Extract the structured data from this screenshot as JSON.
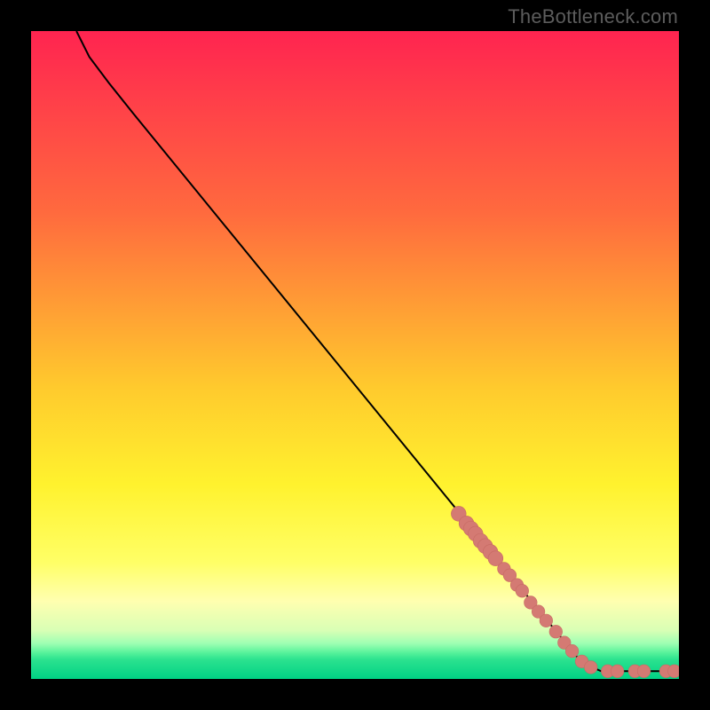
{
  "watermark": "TheBottleneck.com",
  "colors": {
    "background": "#000000",
    "curve": "#000000",
    "marker_fill": "#d47a73",
    "marker_stroke": "#c76a63",
    "gradient_stops": [
      {
        "offset": "0%",
        "color": "#ff2450"
      },
      {
        "offset": "28%",
        "color": "#ff6a3e"
      },
      {
        "offset": "55%",
        "color": "#ffca2d"
      },
      {
        "offset": "70%",
        "color": "#fff22e"
      },
      {
        "offset": "82%",
        "color": "#ffff66"
      },
      {
        "offset": "88%",
        "color": "#ffffb0"
      },
      {
        "offset": "92.5%",
        "color": "#d9ffb5"
      },
      {
        "offset": "94.5%",
        "color": "#9fffb3"
      },
      {
        "offset": "96%",
        "color": "#55f29a"
      },
      {
        "offset": "97%",
        "color": "#2ce28f"
      },
      {
        "offset": "100%",
        "color": "#00d184"
      }
    ]
  },
  "chart_data": {
    "type": "line",
    "title": "",
    "xlabel": "",
    "ylabel": "",
    "xlim": [
      0,
      100
    ],
    "ylim": [
      0,
      100
    ],
    "curve": [
      {
        "x": 7,
        "y": 100
      },
      {
        "x": 9,
        "y": 96
      },
      {
        "x": 12,
        "y": 92
      },
      {
        "x": 16,
        "y": 87
      },
      {
        "x": 85,
        "y": 2.5
      },
      {
        "x": 88,
        "y": 1.2
      },
      {
        "x": 100,
        "y": 1.2
      }
    ],
    "series": [
      {
        "name": "markers",
        "points": [
          {
            "x": 66.0,
            "y": 25.5,
            "r": 1.15
          },
          {
            "x": 67.2,
            "y": 24.0,
            "r": 1.15
          },
          {
            "x": 67.9,
            "y": 23.2,
            "r": 1.15
          },
          {
            "x": 68.6,
            "y": 22.4,
            "r": 1.15
          },
          {
            "x": 69.4,
            "y": 21.3,
            "r": 1.15
          },
          {
            "x": 70.1,
            "y": 20.5,
            "r": 1.15
          },
          {
            "x": 70.9,
            "y": 19.6,
            "r": 1.15
          },
          {
            "x": 71.7,
            "y": 18.6,
            "r": 1.15
          },
          {
            "x": 73.0,
            "y": 17.0,
            "r": 1.0
          },
          {
            "x": 73.9,
            "y": 16.0,
            "r": 1.0
          },
          {
            "x": 75.0,
            "y": 14.5,
            "r": 1.0
          },
          {
            "x": 75.8,
            "y": 13.6,
            "r": 1.0
          },
          {
            "x": 77.1,
            "y": 11.8,
            "r": 1.0
          },
          {
            "x": 78.3,
            "y": 10.4,
            "r": 1.0
          },
          {
            "x": 79.5,
            "y": 9.0,
            "r": 1.0
          },
          {
            "x": 81.0,
            "y": 7.3,
            "r": 1.0
          },
          {
            "x": 82.3,
            "y": 5.6,
            "r": 1.0
          },
          {
            "x": 83.5,
            "y": 4.3,
            "r": 1.0
          },
          {
            "x": 85.0,
            "y": 2.7,
            "r": 1.0
          },
          {
            "x": 86.4,
            "y": 1.8,
            "r": 1.0
          },
          {
            "x": 89.0,
            "y": 1.2,
            "r": 1.0
          },
          {
            "x": 90.5,
            "y": 1.2,
            "r": 1.0
          },
          {
            "x": 93.2,
            "y": 1.2,
            "r": 1.0
          },
          {
            "x": 94.6,
            "y": 1.2,
            "r": 1.0
          },
          {
            "x": 98.0,
            "y": 1.2,
            "r": 1.0
          },
          {
            "x": 99.3,
            "y": 1.2,
            "r": 1.0
          }
        ]
      }
    ]
  }
}
